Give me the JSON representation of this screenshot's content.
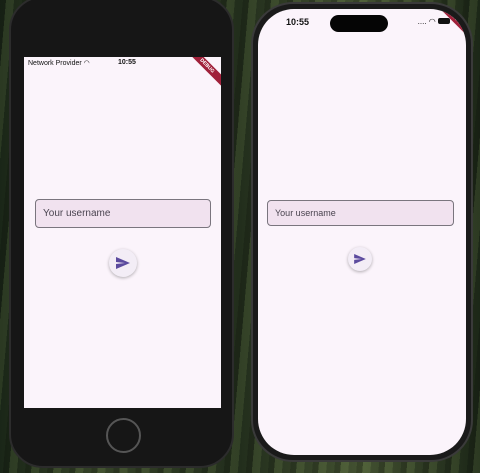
{
  "left_device": {
    "carrier": "Network Provider",
    "time": "10:55",
    "debug_banner": "DEBUG",
    "input_placeholder": "Your username"
  },
  "right_device": {
    "time": "10:55",
    "signal": "....",
    "debug_banner": "DEBUG",
    "input_placeholder": "Your username"
  },
  "colors": {
    "accent": "#5b4a9e",
    "surface": "#fbf4fb",
    "input_bg": "#f1e2ef"
  }
}
